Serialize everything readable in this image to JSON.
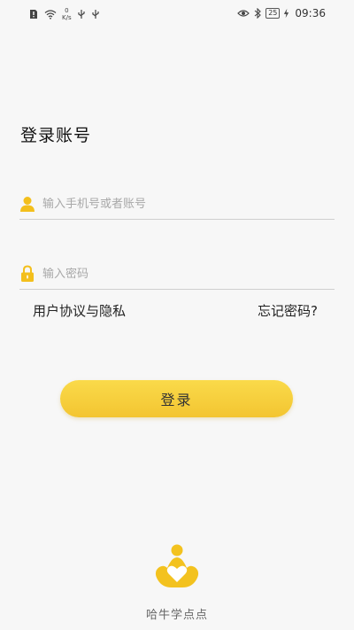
{
  "status_bar": {
    "net_speed_value": "0",
    "net_speed_unit": "K/s",
    "battery": "25",
    "time": "09:36",
    "icons": [
      "sim-alert-icon",
      "wifi-icon",
      "usb-icon",
      "usb-icon",
      "eye-icon",
      "bluetooth-icon",
      "charging-icon"
    ]
  },
  "login": {
    "title": "登录账号",
    "account_placeholder": "输入手机号或者账号",
    "password_placeholder": "输入密码",
    "agreement_link": "用户协议与隐私",
    "forgot_link": "忘记密码?",
    "submit_label": "登录"
  },
  "app": {
    "name": "哈牛学点点"
  },
  "colors": {
    "accent": "#f5c832",
    "background": "#f7f7f7"
  }
}
